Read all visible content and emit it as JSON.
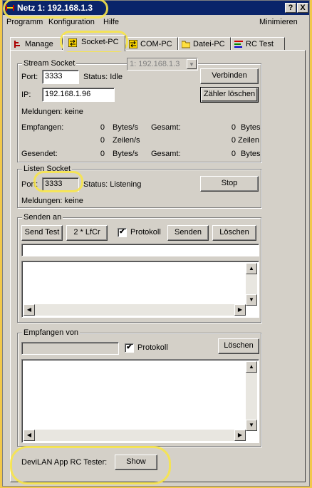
{
  "window": {
    "title": "Netz 1: 192.168.1.3",
    "help_button": "?",
    "close_button": "X"
  },
  "menu": {
    "items": [
      "Programm",
      "Konfiguration",
      "Hilfe"
    ],
    "minimize": "Minimieren"
  },
  "tabs": [
    {
      "label": "Manage",
      "icon": "manage-icon"
    },
    {
      "label": "Socket-PC",
      "icon": "socket-icon",
      "active": true
    },
    {
      "label": "COM-PC",
      "icon": "com-port-icon"
    },
    {
      "label": "Datei-PC",
      "icon": "folder-icon"
    },
    {
      "label": "RC Test",
      "icon": "rc-test-icon"
    }
  ],
  "stream_socket": {
    "title": "Stream Socket",
    "port_label": "Port:",
    "port_value": "3333",
    "status_text": "Status: Idle",
    "network_combo": "1: 192.168.1.3",
    "connect_button": "Verbinden",
    "ip_label": "IP:",
    "ip_value": "192.168.1.96",
    "reset_counter_button": "Zähler löschen",
    "messages": "Meldungen: keine",
    "received_label": "Empfangen:",
    "sent_label": "Gesendet:",
    "total_label": "Gesamt:",
    "recv_bytes_rate": "0",
    "recv_bytes_rate_unit": "Bytes/s",
    "recv_total_bytes": "0",
    "recv_total_bytes_unit": "Bytes",
    "recv_lines_rate": "0",
    "recv_lines_rate_unit": "Zeilen/s",
    "recv_total_lines": "0",
    "recv_total_lines_unit": "Zeilen",
    "sent_bytes_rate": "0",
    "sent_bytes_rate_unit": "Bytes/s",
    "sent_total_bytes": "0",
    "sent_total_bytes_unit": "Bytes"
  },
  "listen_socket": {
    "title": "Listen Socket",
    "port_label": "Port:",
    "port_value": "3333",
    "status_text": "Status: Listening",
    "stop_button": "Stop",
    "messages": "Meldungen: keine"
  },
  "send_to": {
    "title": "Senden an",
    "send_test_button": "Send Test",
    "lfcr_button": "2 * LfCr",
    "protocol_label": "Protokoll",
    "protocol_checked": true,
    "send_button": "Senden",
    "clear_button": "Löschen",
    "input_value": ""
  },
  "receive_from": {
    "title": "Empfangen von",
    "source_value": "",
    "protocol_label": "Protokoll",
    "protocol_checked": true,
    "clear_button": "Löschen"
  },
  "rc_tester": {
    "label": "DeviLAN App RC Tester:",
    "show_button": "Show"
  },
  "colors": {
    "titlebar": "#0a246a",
    "highlight": "#f7e44a",
    "face": "#d4d0c8"
  }
}
